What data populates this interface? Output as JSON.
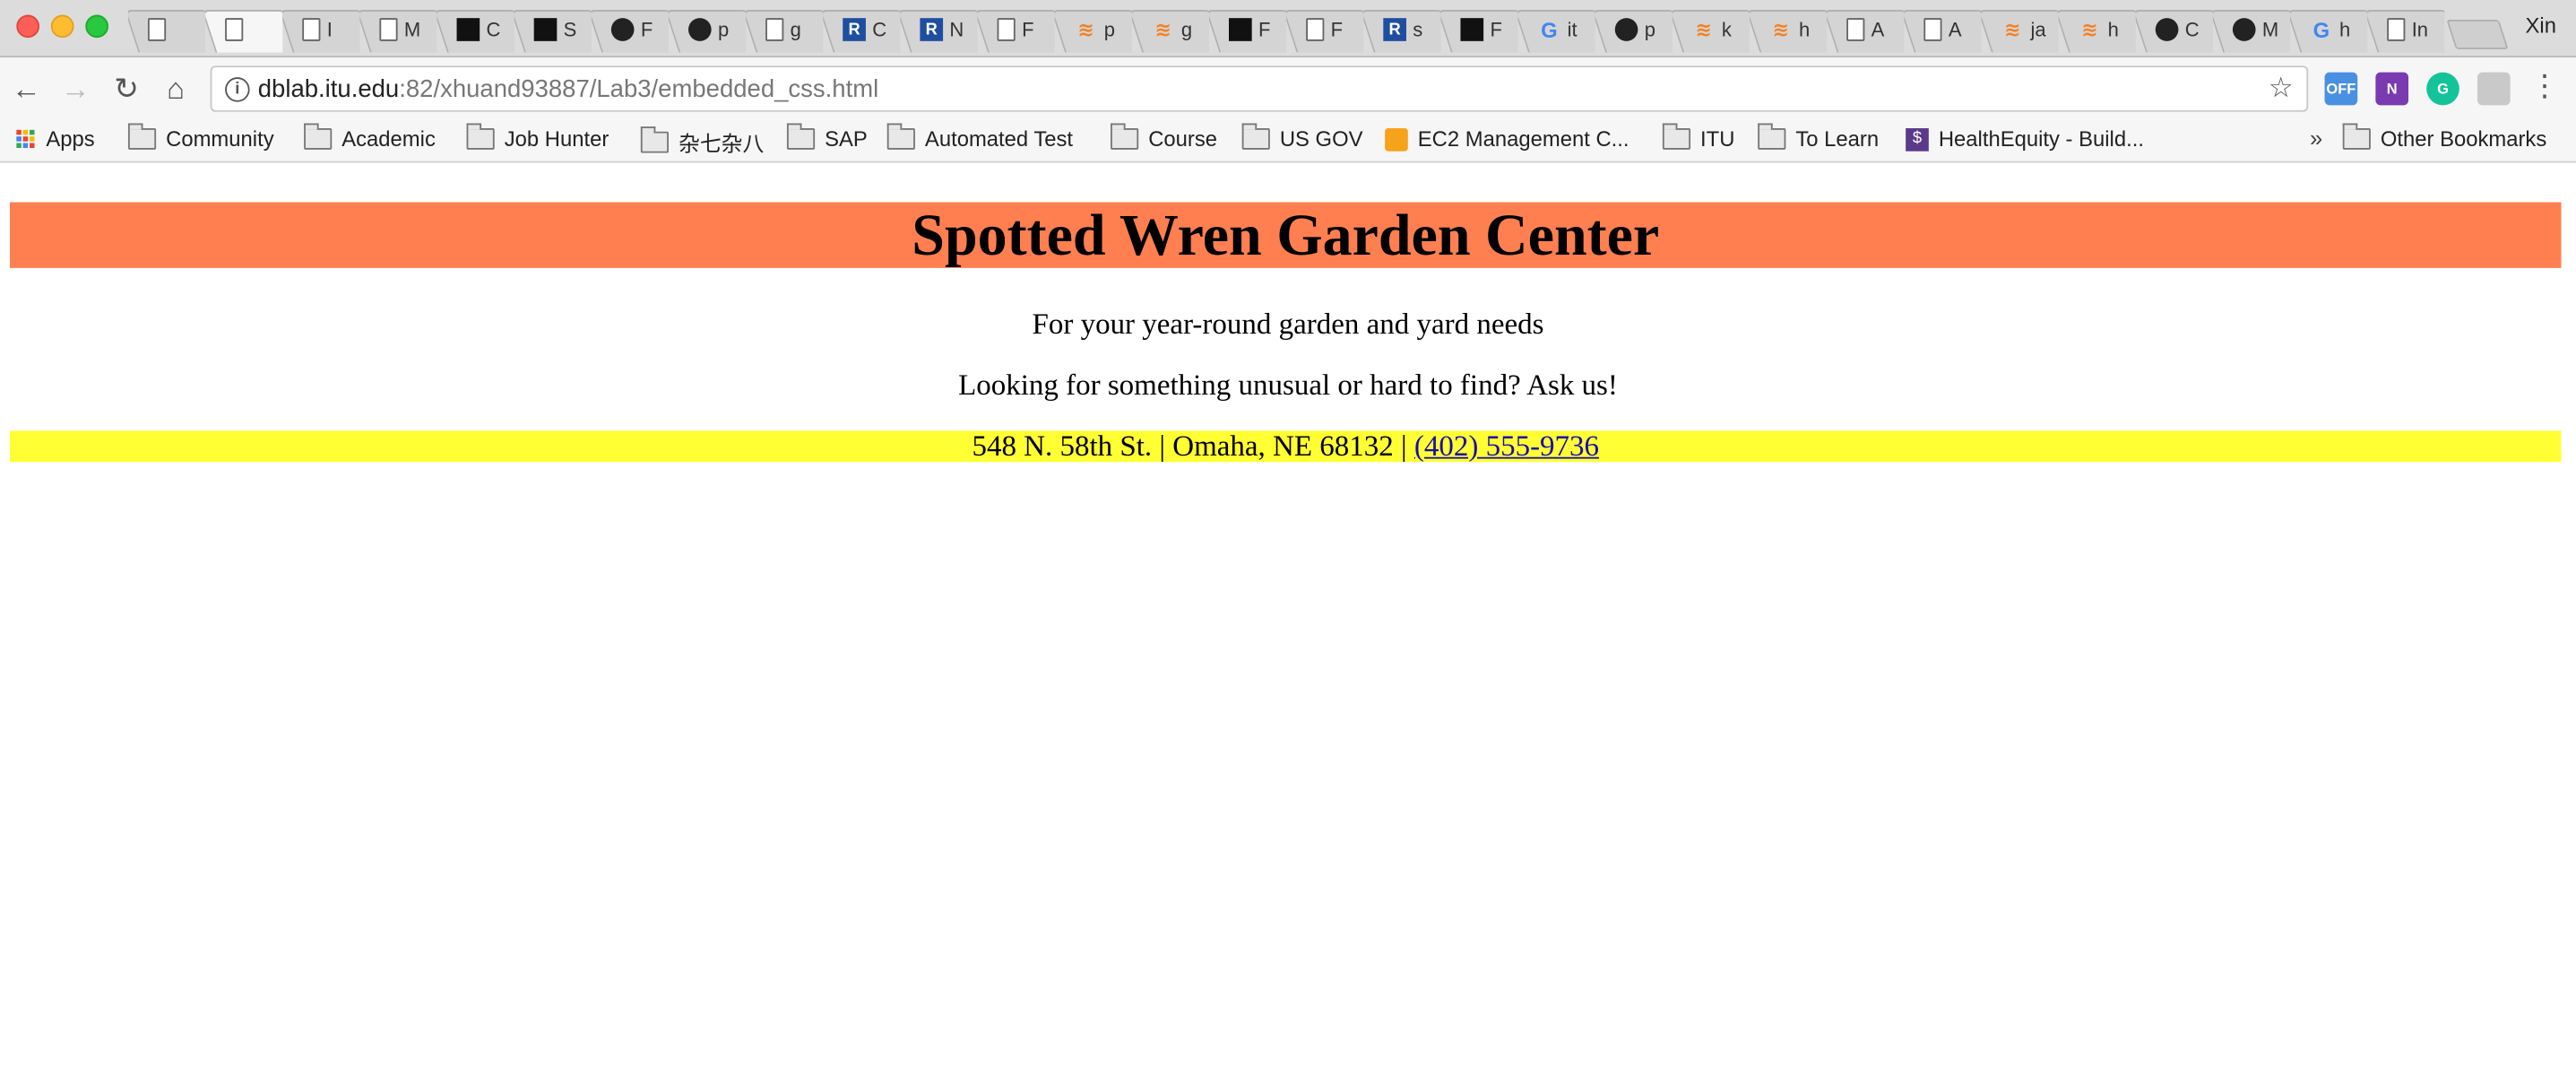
{
  "browser": {
    "profile_name": "Xin",
    "tabs": [
      {
        "icon": "doc-icon",
        "label": ""
      },
      {
        "icon": "doc-icon",
        "label": "",
        "active": true
      },
      {
        "icon": "doc-icon",
        "label": "I"
      },
      {
        "icon": "doc-icon",
        "label": "M"
      },
      {
        "icon": "black-square-icon",
        "label": "C"
      },
      {
        "icon": "vue-icon",
        "label": "S"
      },
      {
        "icon": "github-icon",
        "label": "F"
      },
      {
        "icon": "github-icon",
        "label": "p"
      },
      {
        "icon": "doc-icon",
        "label": "g"
      },
      {
        "icon": "r-icon",
        "label": "C"
      },
      {
        "icon": "r-icon",
        "label": "N"
      },
      {
        "icon": "doc-icon",
        "label": "F"
      },
      {
        "icon": "stackoverflow-icon",
        "label": "p"
      },
      {
        "icon": "stackoverflow-icon",
        "label": "g"
      },
      {
        "icon": "black-square-icon",
        "label": "F"
      },
      {
        "icon": "doc-icon",
        "label": "F"
      },
      {
        "icon": "r-icon",
        "label": "s"
      },
      {
        "icon": "black-square-icon",
        "label": "F"
      },
      {
        "icon": "google-icon",
        "label": "it"
      },
      {
        "icon": "github-icon",
        "label": "p"
      },
      {
        "icon": "stackoverflow-icon",
        "label": "k"
      },
      {
        "icon": "stackoverflow-icon",
        "label": "h"
      },
      {
        "icon": "doc-icon",
        "label": "A"
      },
      {
        "icon": "doc-icon",
        "label": "A"
      },
      {
        "icon": "stackoverflow-icon",
        "label": "ja"
      },
      {
        "icon": "stackoverflow-icon",
        "label": "h"
      },
      {
        "icon": "github-icon",
        "label": "C"
      },
      {
        "icon": "github-icon",
        "label": "M"
      },
      {
        "icon": "google-icon",
        "label": "h"
      },
      {
        "icon": "doc-icon",
        "label": "In"
      }
    ],
    "url_host": "dblab.itu.edu",
    "url_rest": ":82/xhuand93887/Lab3/embedded_css.html",
    "extensions": {
      "off_label": "OFF",
      "onenote_label": "N"
    },
    "bookmarks": [
      {
        "label": "Apps",
        "icon": "apps-grid-icon"
      },
      {
        "label": "Community",
        "icon": "folder-icon"
      },
      {
        "label": "Academic",
        "icon": "folder-icon"
      },
      {
        "label": "Job Hunter",
        "icon": "folder-icon"
      },
      {
        "label": "杂七杂八",
        "icon": "folder-icon"
      },
      {
        "label": "SAP",
        "icon": "folder-icon"
      },
      {
        "label": "Automated Test",
        "icon": "folder-icon"
      },
      {
        "label": "Course",
        "icon": "folder-icon"
      },
      {
        "label": "US GOV",
        "icon": "folder-icon"
      },
      {
        "label": "EC2 Management C...",
        "icon": "aws-icon"
      },
      {
        "label": "ITU",
        "icon": "folder-icon"
      },
      {
        "label": "To Learn",
        "icon": "folder-icon"
      },
      {
        "label": "HealthEquity - Build...",
        "icon": "healthequity-icon"
      }
    ],
    "bookmarks_more": "»",
    "other_bookmarks": "Other Bookmarks"
  },
  "page": {
    "title": "Spotted Wren Garden Center",
    "tagline1": "For your year-round garden and yard needs",
    "tagline2": "Looking for something unusual or hard to find? Ask us!",
    "address": "548 N. 58th St. | Omaha, NE 68132 | ",
    "phone": "(402) 555-9736",
    "colors": {
      "header_bg": "#ff7f50",
      "address_bg": "#ffff33",
      "link": "#1a0dab"
    }
  }
}
